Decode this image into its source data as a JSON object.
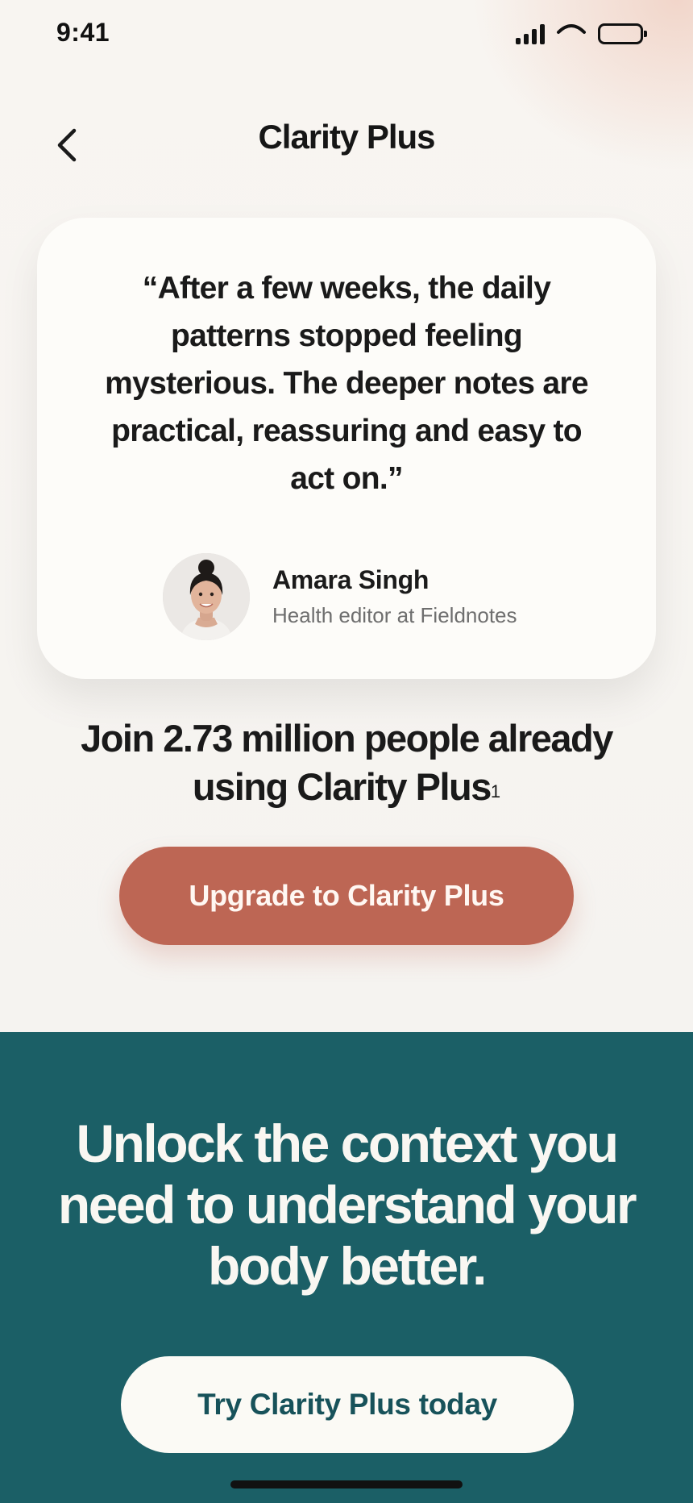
{
  "status_bar": {
    "time": "9:41",
    "icons": [
      "signal-icon",
      "wifi-icon",
      "battery-icon"
    ]
  },
  "header": {
    "title": "Clarity Plus",
    "back_icon": "chevron-left-icon"
  },
  "testimonial": {
    "quote": "“After a few weeks, the daily patterns stopped feeling mysterious. The deeper notes are practical, reassuring and easy to act on.”",
    "author_name": "Amara Singh",
    "author_role": "Health editor at Fieldnotes"
  },
  "join": {
    "text": "Join 2.73 million people already using Clarity Plus",
    "footnote_marker": "1"
  },
  "upgrade_button": {
    "label": "Upgrade to Clarity Plus"
  },
  "bottom": {
    "heading": "Unlock the context you need to understand your body better.",
    "cta_label": "Try Clarity Plus today"
  },
  "colors": {
    "accent": "#bd6654",
    "panel": "#1b5f66",
    "card": "#fdfcf9",
    "cta_text": "#17525a"
  }
}
